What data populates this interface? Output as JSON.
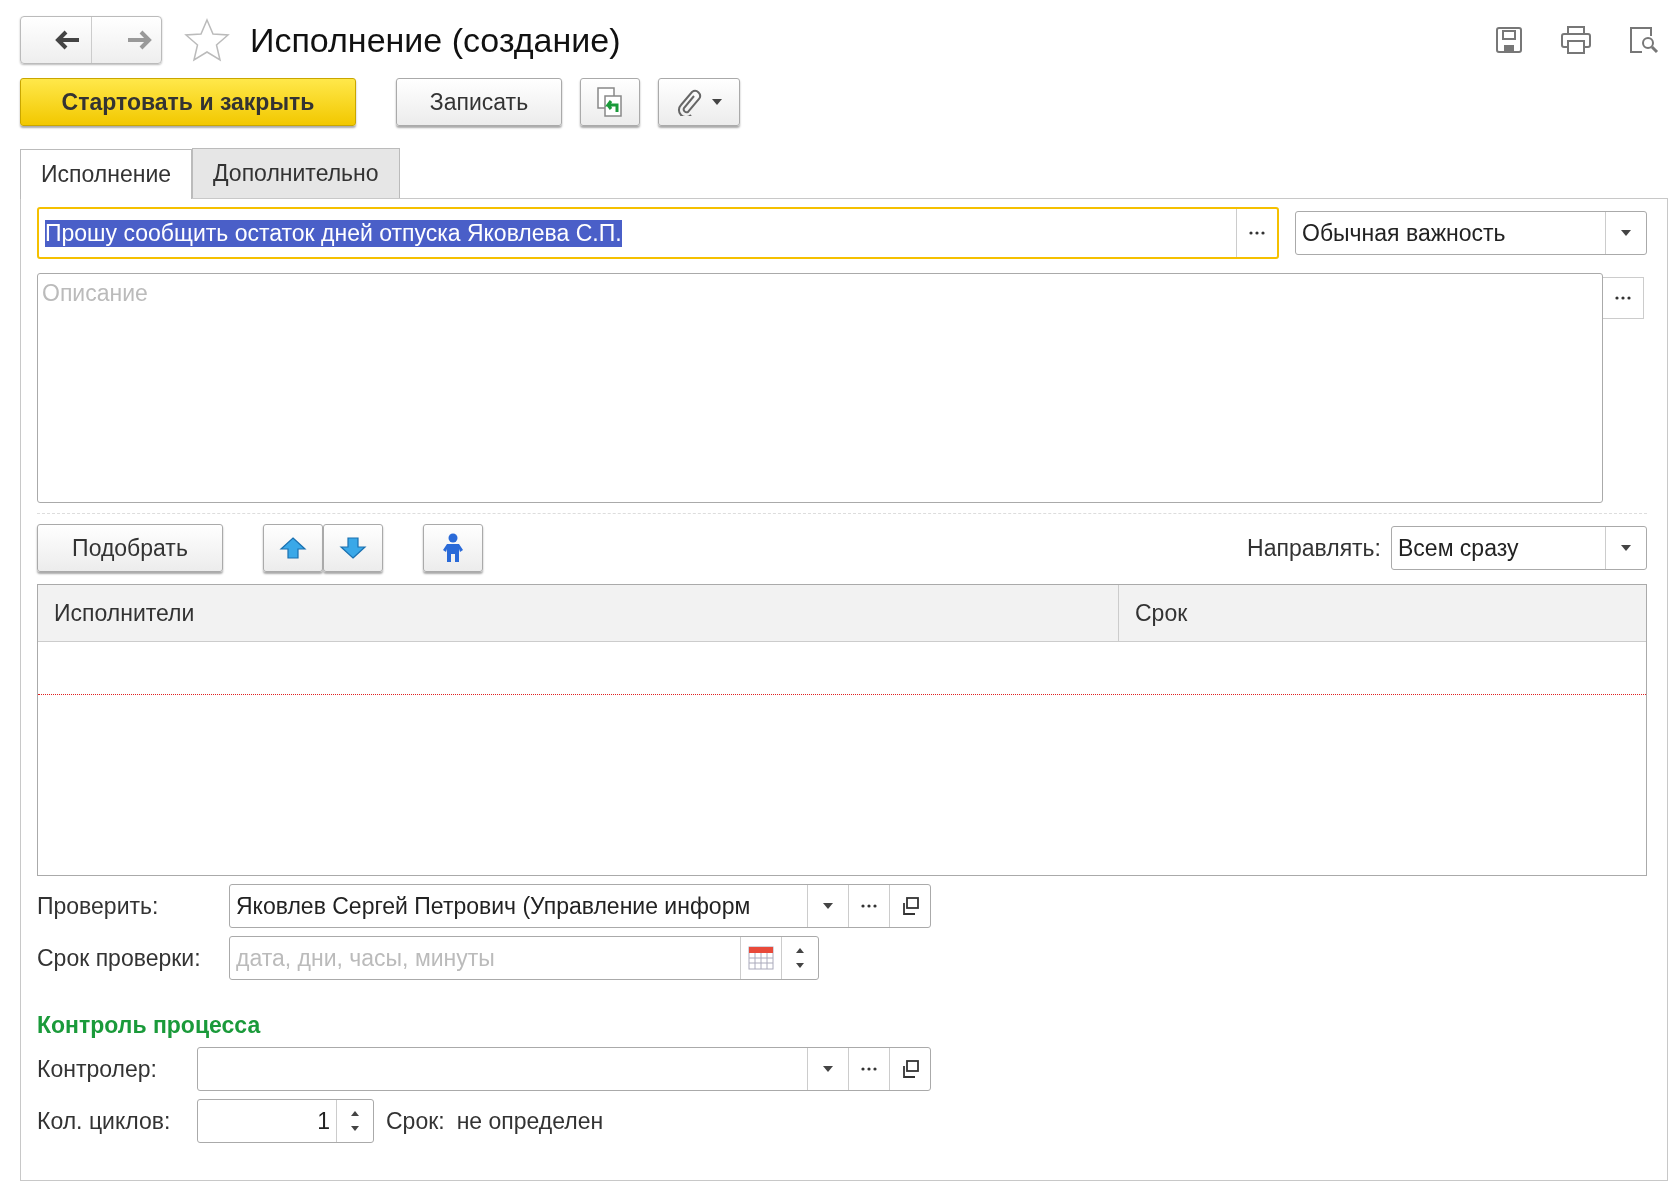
{
  "window": {
    "title": "Исполнение (создание)"
  },
  "toolbar": {
    "primary_button": "Стартовать и закрыть",
    "save_button": "Записать"
  },
  "tabs": [
    {
      "label": "Исполнение",
      "selected": true
    },
    {
      "label": "Дополнительно",
      "selected": false
    }
  ],
  "subject": {
    "value": "Прошу сообщить остаток дней отпуска Яковлева С.П.",
    "focused": true,
    "text_selected": true
  },
  "importance": {
    "value": "Обычная важность"
  },
  "description": {
    "placeholder": "Описание"
  },
  "pick_button": "Подобрать",
  "send_mode": {
    "label": "Направлять:",
    "value": "Всем сразу"
  },
  "table": {
    "columns": [
      "Исполнители",
      "Срок"
    ]
  },
  "check": {
    "label": "Проверить:",
    "value": "Яковлев Сергей Петрович (Управление информ"
  },
  "check_deadline": {
    "label": "Срок проверки:",
    "placeholder": "дата, дни, часы, минуты"
  },
  "process_control": {
    "title": "Контроль процесса",
    "controller_label": "Контролер:",
    "cycles_label": "Кол. циклов:",
    "cycles_value": "1",
    "deadline_label": "Срок:",
    "deadline_value": "не определен"
  }
}
